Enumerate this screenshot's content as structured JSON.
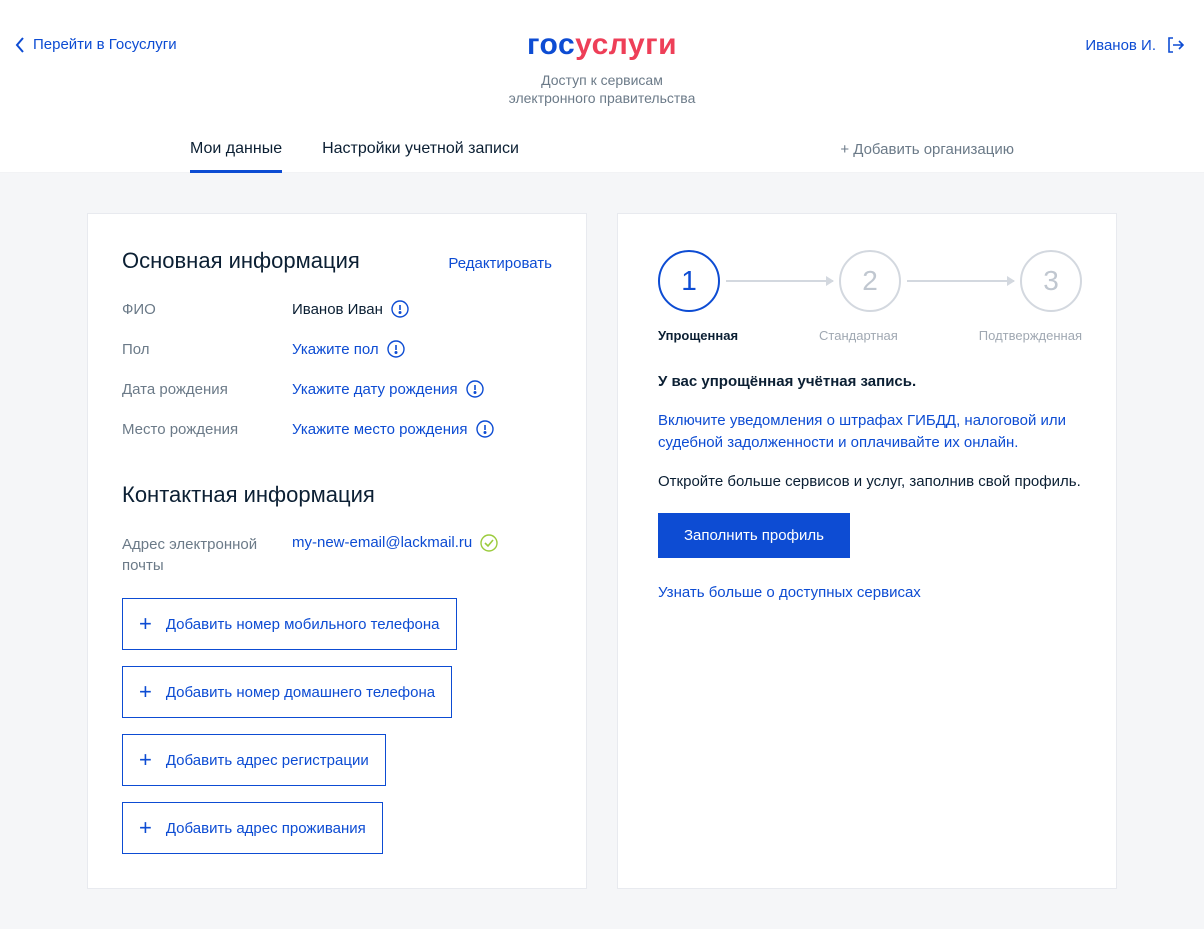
{
  "header": {
    "back_label": "Перейти в Госуслуги",
    "user_name": "Иванов И.",
    "logo_part1": "гос",
    "logo_part2": "услуги",
    "sub1": "Доступ к сервисам",
    "sub2": "электронного правительства"
  },
  "tabs": {
    "tab1": "Мои данные",
    "tab2": "Настройки учетной записи",
    "add_org": "+ Добавить организацию"
  },
  "basic": {
    "title": "Основная информация",
    "edit": "Редактировать",
    "fio_label": "ФИО",
    "fio_value": "Иванов Иван",
    "gender_label": "Пол",
    "gender_value": "Укажите пол",
    "dob_label": "Дата рождения",
    "dob_value": "Укажите дату рождения",
    "pob_label": "Место рождения",
    "pob_value": "Укажите место рождения"
  },
  "contact": {
    "title": "Контактная информация",
    "email_label": "Адрес электронной почты",
    "email_value": "my-new-email@lackmail.ru",
    "add_mobile": "Добавить номер мобильного телефона",
    "add_home": "Добавить номер домашнего телефона",
    "add_reg": "Добавить адрес регистрации",
    "add_live": "Добавить адрес проживания"
  },
  "right": {
    "step1": "1",
    "step2": "2",
    "step3": "3",
    "label1": "Упрощенная",
    "label2": "Стандартная",
    "label3": "Подтвержденная",
    "bold": "У вас упрощённая учётная запись.",
    "blue": "Включите уведомления о штрафах ГИБДД, налоговой или судебной задолженности и оплачивайте их онлайн.",
    "plain": "Откройте больше сервисов и услуг, заполнив свой профиль.",
    "btn": "Заполнить профиль",
    "more": "Узнать больше о доступных сервисах"
  }
}
